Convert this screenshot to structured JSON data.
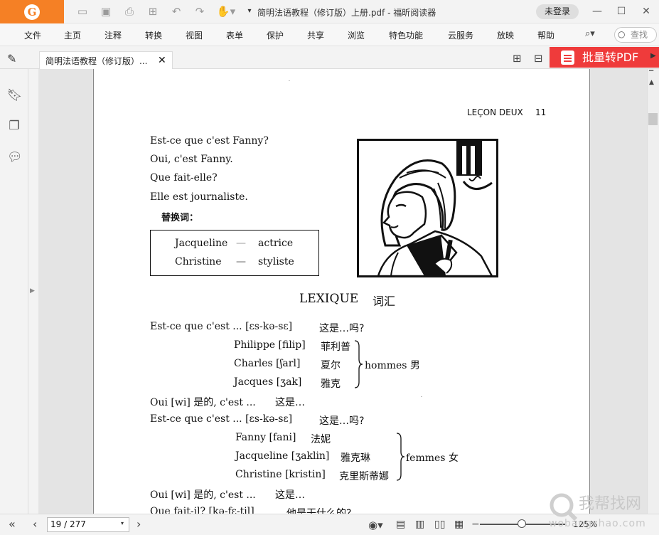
{
  "app": {
    "window_title": "简明法语教程（修订版）上册.pdf - 福昕阅读器",
    "login_label": "未登录",
    "logo_glyph": "G",
    "accent_color": "#f58025"
  },
  "menu": {
    "items": [
      "文件",
      "主页",
      "注释",
      "转换",
      "视图",
      "表单",
      "保护",
      "共享",
      "浏览",
      "特色功能",
      "云服务",
      "放映",
      "帮助"
    ],
    "search_placeholder": "查找"
  },
  "tabs": {
    "doc_tab_label": "简明法语教程（修订版）...",
    "batch_button_label": "批量转PDF",
    "batch_button_color": "#ef3b3b"
  },
  "document": {
    "header_left": "LEÇON DEUX",
    "header_page": "11",
    "dialogue": [
      "Est-ce que c'est Fanny?",
      "Oui, c'est Fanny.",
      "Que fait-elle?",
      "Elle est journaliste."
    ],
    "substitution_title": "替换词：",
    "substitution_rows": [
      {
        "name": "Jacqueline",
        "dash": "—",
        "job": "actrice"
      },
      {
        "name": "Christine",
        "dash": "—",
        "job": "styliste"
      }
    ],
    "lexique_title": "LEXIQUE",
    "lexique_title_cn": "词汇",
    "lines": {
      "q1_fr": "Est-ce que c'est ... [ɛs-kə-sɛ]",
      "q1_cn": "这是…吗?",
      "m1": "Philippe [filip]",
      "m1_cn": "菲利普",
      "m2": "Charles [ʃarl]",
      "m2_cn": "夏尔",
      "m3": "Jacques [ʒak]",
      "m3_cn": "雅克",
      "men_group": "hommes 男",
      "oui1": "Oui [wi] 是的, c'est ...",
      "oui1_cn": "这是…",
      "q2_fr": "Est-ce que c'est ... [ɛs-kə-sɛ]",
      "q2_cn": "这是…吗?",
      "f1": "Fanny [fani]",
      "f1_cn": "法妮",
      "f2": "Jacqueline [ʒaklin]",
      "f2_cn": "雅克琳",
      "f3": "Christine [kristin]",
      "f3_cn": "克里斯蒂娜",
      "women_group": "femmes 女",
      "oui2": "Oui [wi] 是的, c'est ...",
      "oui2_cn": "这是…",
      "que_fait": "Que fait-il? [kə-fɛ-til]",
      "que_fait_cn": "他是干什么的?"
    }
  },
  "status": {
    "page_indicator": "19 / 277",
    "zoom": "125%"
  },
  "watermark": {
    "cn": "我帮找网",
    "url": "wobangzhao.com"
  }
}
